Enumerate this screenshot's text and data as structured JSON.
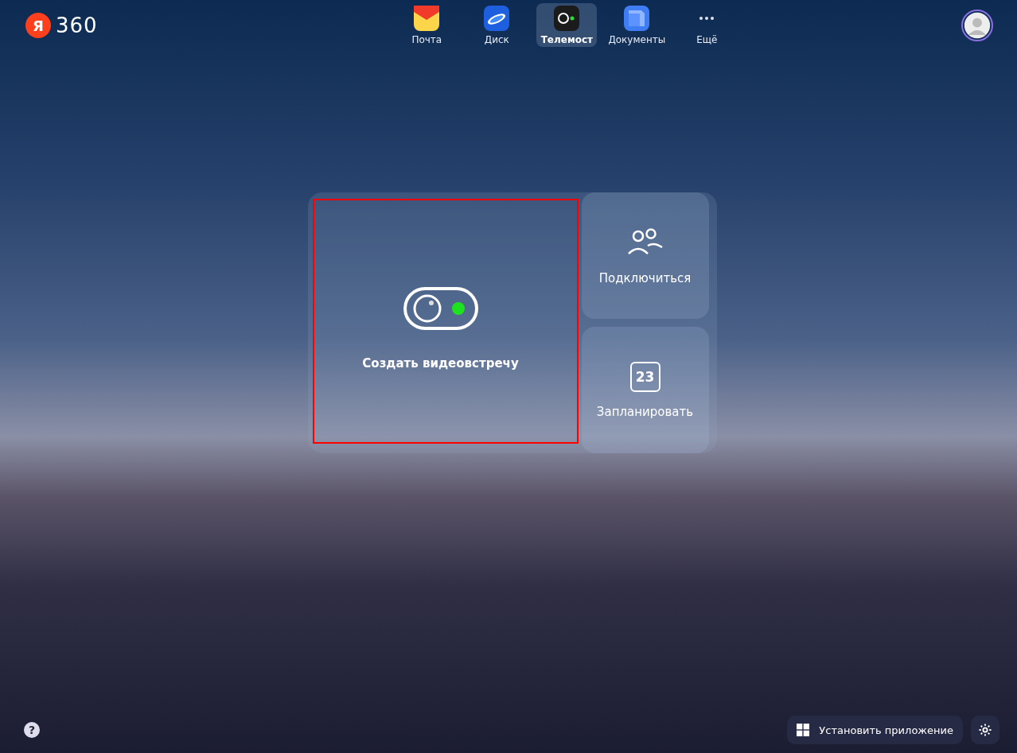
{
  "logo": {
    "mark": "Я",
    "text": "360"
  },
  "nav": [
    {
      "label": "Почта",
      "kind": "mail",
      "selected": false
    },
    {
      "label": "Диск",
      "kind": "disk",
      "selected": false
    },
    {
      "label": "Телемост",
      "kind": "telemost",
      "selected": true
    },
    {
      "label": "Документы",
      "kind": "docs",
      "selected": false
    },
    {
      "label": "Ещё",
      "kind": "more",
      "selected": false
    }
  ],
  "actions": {
    "main": {
      "label": "Создать видеовстречу"
    },
    "side": [
      {
        "label": "Подключиться",
        "kind": "join"
      },
      {
        "label": "Запланировать",
        "kind": "schedule",
        "day": "23"
      }
    ]
  },
  "footer": {
    "help": "?",
    "install": "Установить приложение"
  }
}
